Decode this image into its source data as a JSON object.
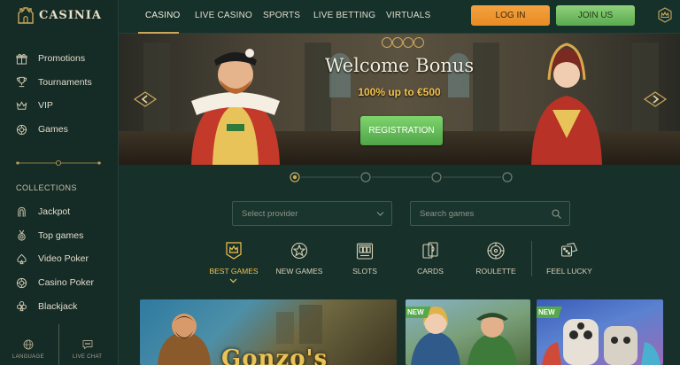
{
  "brand": {
    "name": "CASINIA"
  },
  "colors": {
    "accent_gold": "#c9a85d",
    "login": "#f0983a",
    "join": "#76c264",
    "bg": "#17302a",
    "bonus_text": "#f2c24e"
  },
  "sidebar": {
    "items": [
      {
        "label": "Promotions",
        "icon": "gift-icon"
      },
      {
        "label": "Tournaments",
        "icon": "trophy-icon"
      },
      {
        "label": "VIP",
        "icon": "crown-icon"
      },
      {
        "label": "Games",
        "icon": "chip-icon"
      }
    ],
    "collections_title": "COLLECTIONS",
    "collections": [
      {
        "label": "Jackpot",
        "icon": "horseshoe-icon"
      },
      {
        "label": "Top games",
        "icon": "medal-icon"
      },
      {
        "label": "Video Poker",
        "icon": "spade-icon"
      },
      {
        "label": "Casino Poker",
        "icon": "chip-icon"
      },
      {
        "label": "Blackjack",
        "icon": "club-icon"
      }
    ],
    "bottom": {
      "language": "LANGUAGE",
      "live_chat": "LIVE CHAT"
    }
  },
  "topnav": {
    "items": [
      "CASINO",
      "LIVE CASINO",
      "SPORTS",
      "LIVE BETTING",
      "VIRTUALS"
    ],
    "active": "CASINO",
    "login": "LOG IN",
    "join": "JOIN US"
  },
  "hero": {
    "title": "Welcome Bonus",
    "subtitle": "100% up to €500",
    "button": "REGISTRATION",
    "slides": 4,
    "active_slide": 1
  },
  "filters": {
    "provider_placeholder": "Select provider",
    "search_placeholder": "Search games"
  },
  "categories": [
    {
      "label": "BEST GAMES",
      "icon": "crown-badge-icon",
      "active": true
    },
    {
      "label": "NEW GAMES",
      "icon": "starburst-icon"
    },
    {
      "label": "SLOTS",
      "icon": "slot-machine-icon"
    },
    {
      "label": "CARDS",
      "icon": "cards-icon"
    },
    {
      "label": "ROULETTE",
      "icon": "roulette-icon"
    },
    {
      "label": "FEEL LUCKY",
      "icon": "dice-icon"
    }
  ],
  "games": [
    {
      "title": "Gonzo's",
      "badge": ""
    },
    {
      "title": "",
      "badge": "NEW"
    },
    {
      "title": "",
      "badge": "NEW"
    }
  ]
}
